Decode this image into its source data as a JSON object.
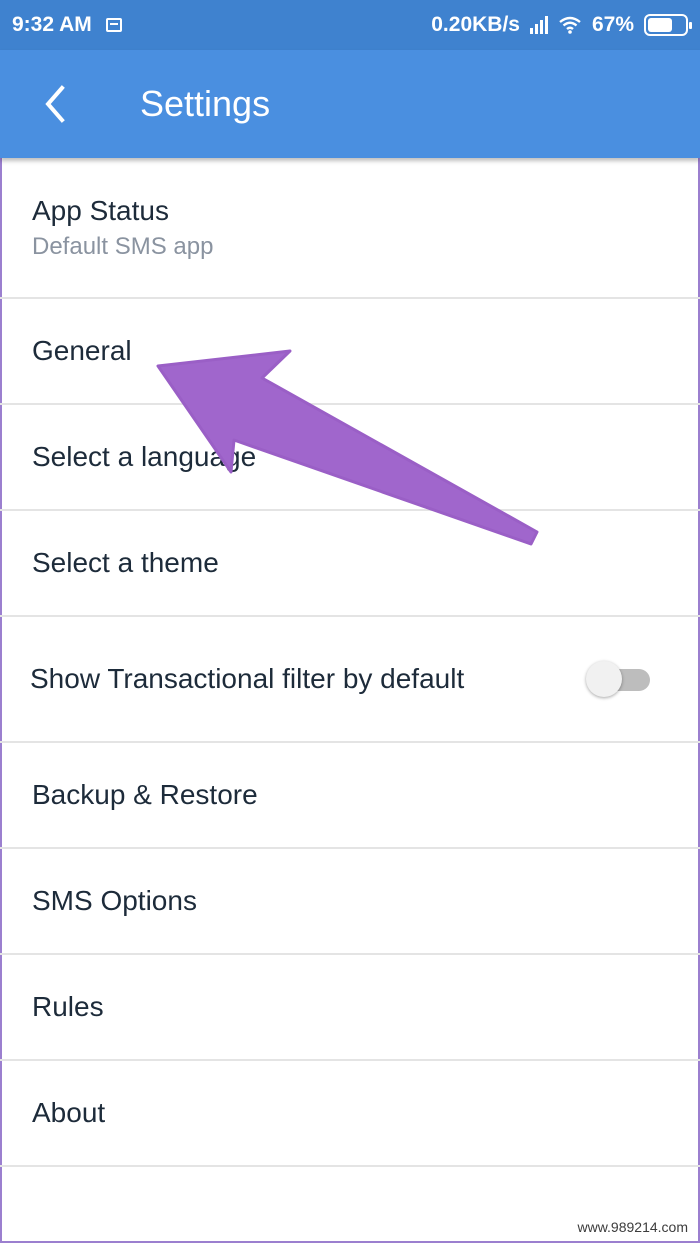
{
  "status_bar": {
    "time": "9:32 AM",
    "network_speed": "0.20KB/s",
    "battery_percent": "67%",
    "battery_level": 0.67,
    "icons": [
      "notification-icon",
      "signal-icon",
      "wifi-icon",
      "battery-icon"
    ]
  },
  "toolbar": {
    "title": "Settings",
    "back_icon": "back-arrow-icon",
    "background_color": "#4a8fe0"
  },
  "settings": {
    "items": [
      {
        "label": "App Status",
        "sublabel": "Default SMS app"
      },
      {
        "label": "General"
      },
      {
        "label": "Select a language"
      },
      {
        "label": "Select a theme"
      },
      {
        "label": "Show Transactional filter by default",
        "toggle_on": false
      },
      {
        "label": "Backup & Restore"
      },
      {
        "label": "SMS Options"
      },
      {
        "label": "Rules"
      },
      {
        "label": "About"
      }
    ]
  },
  "annotation": {
    "type": "arrow",
    "color": "#a066cc",
    "points_to": "General"
  },
  "watermark": "www.989214.com"
}
